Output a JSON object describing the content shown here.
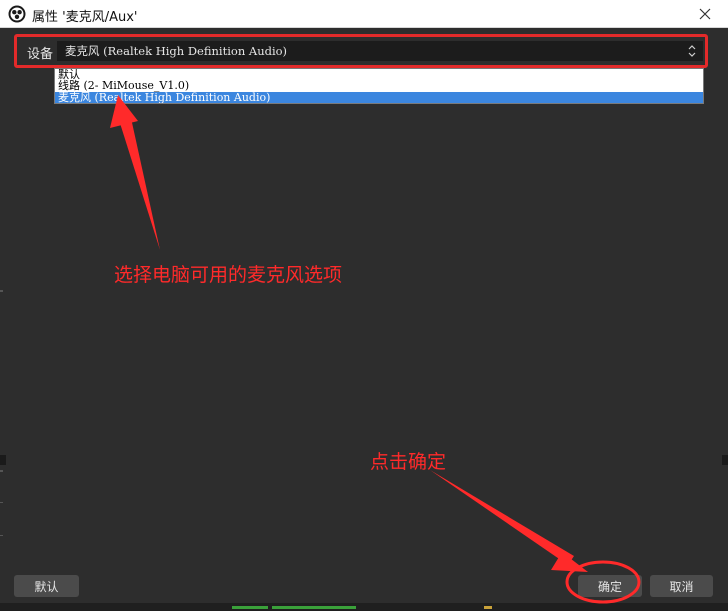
{
  "window": {
    "title": "属性 '麦克风/Aux'"
  },
  "device": {
    "label": "设备",
    "selected_value": "麦克风 (Realtek High Definition Audio)",
    "options": [
      {
        "label": "默认"
      },
      {
        "label": "线路 (2- MiMouse_V1.0)"
      },
      {
        "label": "麦克风 (Realtek High Definition Audio)",
        "selected": true
      }
    ]
  },
  "annotations": {
    "choose_mic": "选择电脑可用的麦克风选项",
    "click_ok": "点击确定",
    "color": "#ff2a2a"
  },
  "buttons": {
    "defaults": "默认",
    "ok": "确定",
    "cancel": "取消"
  },
  "theme": {
    "bg": "#2d2d2d",
    "selection": "#3b86df",
    "highlight_border": "#e32a2a"
  },
  "icons": {
    "app": "obs-logo-icon",
    "close": "close-icon",
    "select": "updown-arrows-icon"
  }
}
